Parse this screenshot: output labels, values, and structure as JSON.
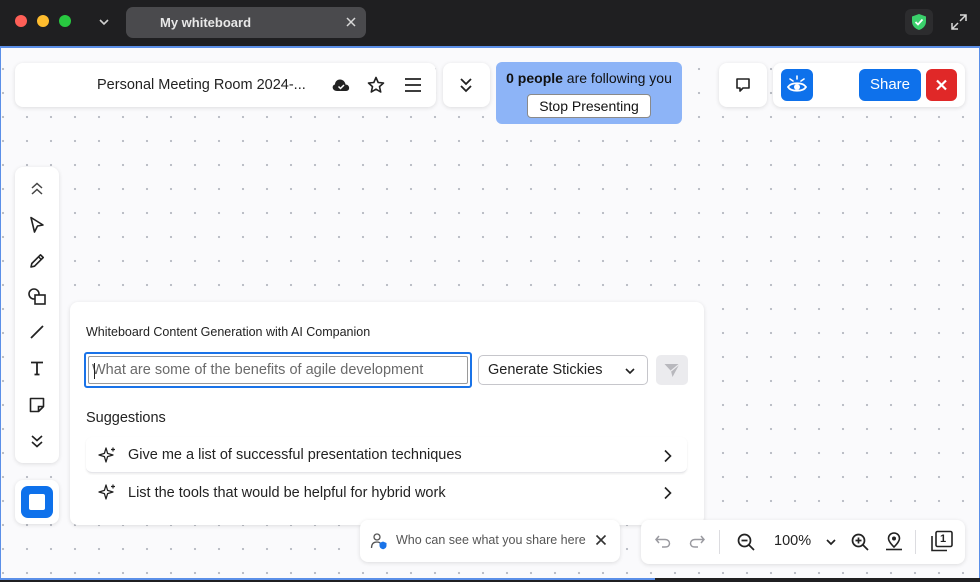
{
  "window": {
    "tab_title": "My whiteboard",
    "icons": [
      "chevron-down-icon",
      "close-icon",
      "shield-check-icon",
      "expand-icon"
    ],
    "colors": {
      "shield": "#3ad06b"
    }
  },
  "header": {
    "meeting_title": "Personal Meeting Room 2024-...",
    "icons": [
      "cloud-sync-icon",
      "star-icon",
      "menu-icon",
      "collapse-double-chevron-icon"
    ]
  },
  "follow_banner": {
    "count": "0 people",
    "suffix": " are following you",
    "stop_label": "Stop Presenting",
    "color": "#8db4f7"
  },
  "actions": {
    "share_label": "Share",
    "icons": [
      "comment-icon",
      "eye-visibility-icon",
      "close-icon"
    ],
    "colors": {
      "share": "#0e71eb",
      "close": "#e02828"
    }
  },
  "toolbar": {
    "tools": [
      "collapse-up-icon",
      "select-pointer-icon",
      "pen-icon",
      "shapes-icon",
      "line-icon",
      "text-icon",
      "sticky-note-icon",
      "expand-down-icon"
    ],
    "active_color_icon": "square-shape-icon"
  },
  "ai_panel": {
    "title": "Whiteboard Content Generation with AI Companion",
    "input_placeholder": "What are some of the benefits of agile development",
    "input_value": "",
    "mode_selected": "Generate Stickies",
    "suggestions_title": "Suggestions",
    "suggestions": [
      {
        "label": "Give me a list of successful presentation techniques"
      },
      {
        "label": "List the tools that would be helpful for hybrid work"
      }
    ]
  },
  "privacy_notice": {
    "text": "Who can see what you share here"
  },
  "bottom_bar": {
    "zoom": "100%",
    "page_count": "1",
    "icons": [
      "undo-icon",
      "redo-icon",
      "zoom-out-icon",
      "zoom-in-icon",
      "location-pin-icon",
      "pages-icon"
    ]
  }
}
